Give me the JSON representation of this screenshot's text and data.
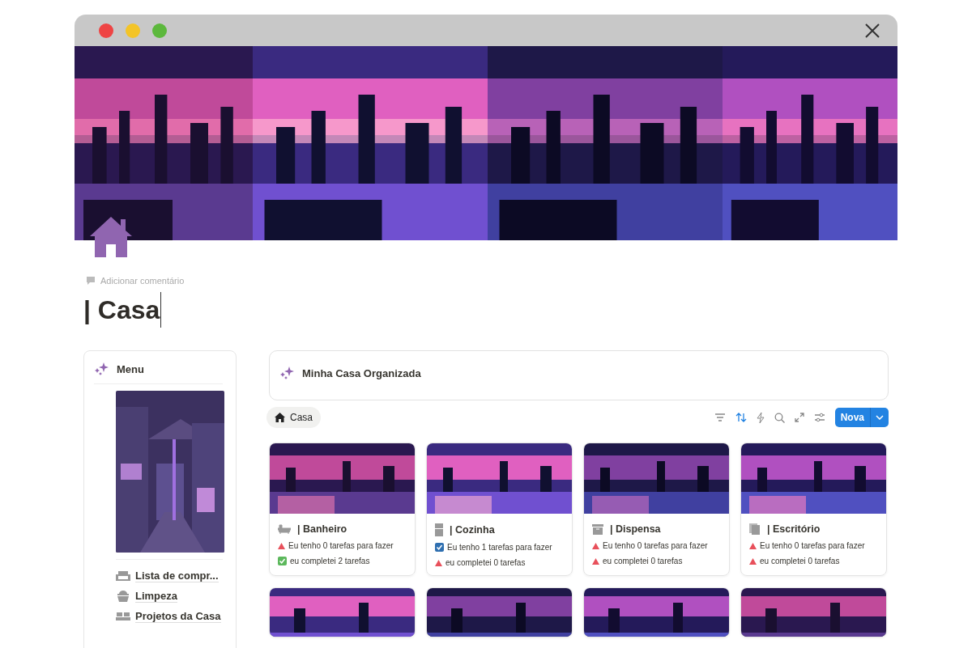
{
  "page": {
    "comment_prompt": "Adicionar comentário",
    "title": "| Casa"
  },
  "menu": {
    "title": "Menu",
    "links": [
      {
        "label": "Lista de compr..."
      },
      {
        "label": "Limpeza"
      },
      {
        "label": "Projetos da Casa"
      }
    ]
  },
  "board": {
    "title": "Minha Casa Organizada",
    "view_tab": "Casa",
    "new_button": "Nova",
    "cards": [
      {
        "title": "| Banheiro",
        "lines": [
          {
            "kind": "alert",
            "text": "Eu tenho 0 tarefas para fazer"
          },
          {
            "kind": "done",
            "text": "eu completei 2 tarefas"
          }
        ]
      },
      {
        "title": "| Cozinha",
        "lines": [
          {
            "kind": "check",
            "text": "Eu tenho 1 tarefas para fazer"
          },
          {
            "kind": "alert",
            "text": "eu completei 0 tarefas"
          }
        ]
      },
      {
        "title": "| Dispensa",
        "lines": [
          {
            "kind": "alert",
            "text": "Eu tenho 0 tarefas para fazer"
          },
          {
            "kind": "alert",
            "text": "eu completei 0 tarefas"
          }
        ]
      },
      {
        "title": "| Escritório",
        "lines": [
          {
            "kind": "alert",
            "text": "Eu tenho 0 tarefas para fazer"
          },
          {
            "kind": "alert",
            "text": "eu completei 0 tarefas"
          }
        ]
      }
    ]
  }
}
